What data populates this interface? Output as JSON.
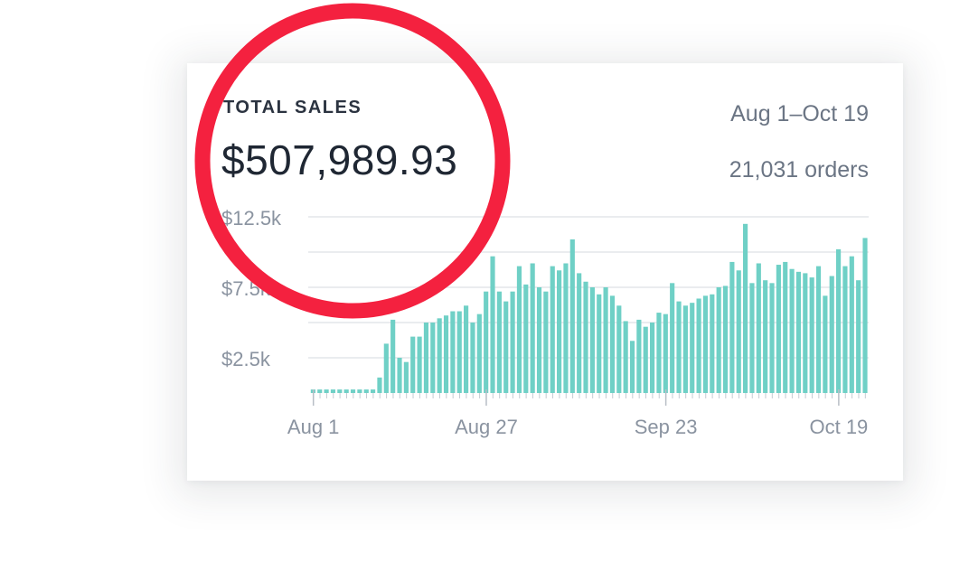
{
  "card": {
    "title": "TOTAL SALES",
    "total": "$507,989.93",
    "date_range": "Aug 1–Oct 19",
    "orders": "21,031 orders"
  },
  "highlight": {
    "color": "#f4213f"
  },
  "chart_data": {
    "type": "bar",
    "color": "#6fd0c6",
    "ylim": [
      0,
      12500
    ],
    "ytick_values": [
      2500,
      7500,
      12500
    ],
    "ytick_labels": [
      "$2.5k",
      "$7.5k",
      "$12.5k"
    ],
    "gridlines": [
      2500,
      5000,
      7500,
      10000,
      12500
    ],
    "xtick_labels": [
      "Aug 1",
      "Aug 27",
      "Sep 23",
      "Oct 19"
    ],
    "xtick_indices": [
      0,
      26,
      53,
      79
    ],
    "values": [
      250,
      250,
      250,
      250,
      250,
      250,
      250,
      250,
      250,
      250,
      1100,
      3500,
      5200,
      2500,
      2200,
      4000,
      4000,
      5000,
      5000,
      5300,
      5500,
      5800,
      5800,
      6200,
      5000,
      5600,
      7200,
      9700,
      7200,
      6500,
      7200,
      9000,
      7700,
      9200,
      7500,
      7200,
      9000,
      8700,
      9200,
      10900,
      8500,
      7900,
      7500,
      7000,
      7500,
      6900,
      6200,
      5100,
      3700,
      5200,
      4700,
      5000,
      5700,
      5600,
      7800,
      6500,
      6200,
      6400,
      6700,
      6900,
      7000,
      7500,
      7600,
      9300,
      8700,
      12000,
      7800,
      9200,
      8000,
      7800,
      9100,
      9300,
      8800,
      8600,
      8500,
      8200,
      9000,
      6900,
      8300,
      10200,
      9000,
      9700,
      8000,
      11000
    ]
  }
}
